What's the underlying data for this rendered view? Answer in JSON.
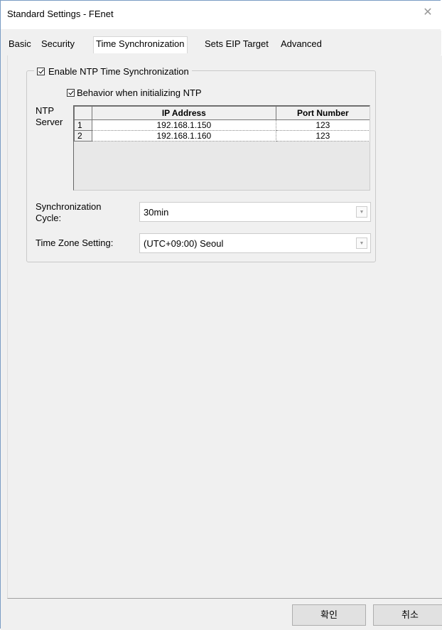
{
  "window": {
    "title": "Standard Settings - FEnet",
    "close_glyph": "✕"
  },
  "tabs": [
    {
      "label": "Basic",
      "active": false
    },
    {
      "label": "Security",
      "active": false
    },
    {
      "label": "Time Synchronization",
      "active": true
    },
    {
      "label": "Sets EIP Target",
      "active": false
    },
    {
      "label": "Advanced",
      "active": false
    }
  ],
  "ntp": {
    "enable_label": "Enable NTP Time Synchronization",
    "enable_checked": true,
    "behavior_label": "Behavior when initializing NTP",
    "behavior_checked": true,
    "server_label": "NTP Server",
    "columns": [
      "",
      "IP Address",
      "Port Number"
    ],
    "rows": [
      {
        "num": "1",
        "ip": "192.168.1.150",
        "port": "123"
      },
      {
        "num": "2",
        "ip": "192.168.1.160",
        "port": "123"
      }
    ]
  },
  "sync_cycle": {
    "label_line1": "Synchronization",
    "label_line2": "Cycle:",
    "value": "30min"
  },
  "time_zone": {
    "label": "Time Zone Setting:",
    "value": "(UTC+09:00) Seoul"
  },
  "buttons": {
    "ok_label": "확인",
    "cancel_label": "취소"
  },
  "icons": {
    "combo_arrow": "▼"
  }
}
